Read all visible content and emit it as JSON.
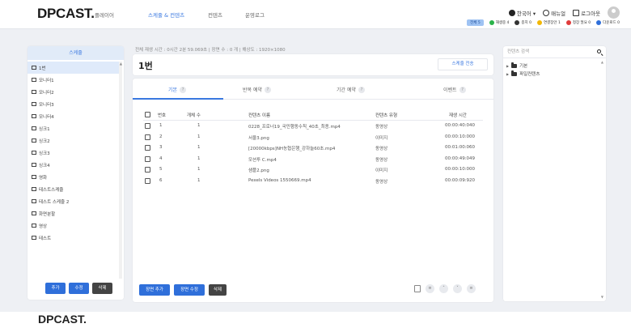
{
  "header": {
    "logo": "DPCAST.",
    "nav": [
      "플레이어",
      "스케줄 & 컨텐츠",
      "컨텐츠",
      "운영로그"
    ],
    "active_nav": 1,
    "language": "한국어 ▾",
    "manual": "매뉴얼",
    "logout": "로그아웃"
  },
  "status_bar": {
    "total": "전체 5",
    "items": [
      {
        "label": "재생중 4",
        "color": "#2bb34a"
      },
      {
        "label": "종지 0",
        "color": "#333333"
      },
      {
        "label": "연결장안 1",
        "color": "#f2b705"
      },
      {
        "label": "정장 멀요 0",
        "color": "#e03b3b"
      },
      {
        "label": "다운로드 0",
        "color": "#2f6fda"
      }
    ]
  },
  "left_panel": {
    "title": "스케줄",
    "items": [
      "1번",
      "모니터1",
      "모니터2",
      "모니터3",
      "모니터4",
      "싱크1",
      "싱크2",
      "싱크3",
      "싱크4",
      "영화",
      "테스트스케줄",
      "테스트 스케줄 2",
      "화면분할",
      "영상",
      "테스트"
    ],
    "selected": 0,
    "buttons": {
      "add": "추가",
      "edit": "수정",
      "delete": "삭제"
    }
  },
  "info_line": "전체 재생 시간 : 0시간 2분 59.069초  |  장면 수 : 0 개  |  해상도 : 1920×1080",
  "schedule": {
    "title": "1번",
    "send_button": "스케줄 전송"
  },
  "tabs": [
    {
      "label": "기본",
      "help": "?"
    },
    {
      "label": "반복 예약",
      "help": "?"
    },
    {
      "label": "기간 예약",
      "help": "?"
    },
    {
      "label": "이벤트",
      "help": "?"
    }
  ],
  "table": {
    "headers": [
      "번호",
      "개체 수",
      "컨텐츠 이름",
      "컨텐츠 유형",
      "재생 시간"
    ],
    "rows": [
      [
        "1",
        "1",
        "0228_프로너19_국민행동수칙_40초_최종.mp4",
        "동영상",
        "00:00:40:040"
      ],
      [
        "2",
        "1",
        "서울3.png",
        "이미지",
        "00:00:10:000"
      ],
      [
        "3",
        "1",
        "[20000kbps]NH농협은행_강하늘60초.mp4",
        "동영상",
        "00:01:00:060"
      ],
      [
        "4",
        "1",
        "모션투 C.mp4",
        "동영상",
        "00:00:49:049"
      ],
      [
        "5",
        "1",
        "샘플2.png",
        "이미지",
        "00:00:10:000"
      ],
      [
        "6",
        "1",
        "Pexels Videos 1550669.mp4",
        "동영상",
        "00:00:09:920"
      ]
    ]
  },
  "main_buttons": {
    "add_scene": "장면 추가",
    "edit_scene": "장면 수정",
    "delete": "삭제"
  },
  "right_panel": {
    "search_placeholder": "컨텐츠 검색",
    "tree": [
      "기본",
      "파일컨텐츠"
    ]
  },
  "footer": {
    "logo": "DPCAST."
  }
}
